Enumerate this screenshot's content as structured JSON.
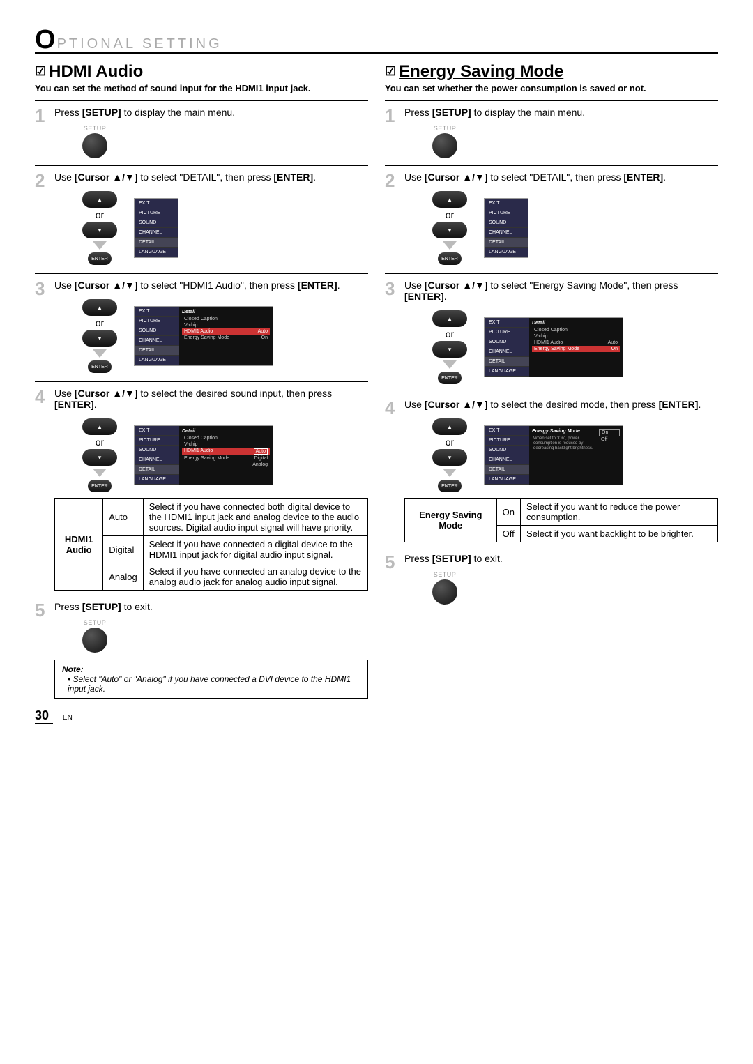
{
  "header": {
    "big_o": "O",
    "rest": "PTIONAL  SETTING"
  },
  "left": {
    "check": "☑",
    "title": "HDMI Audio",
    "subtitle": "You can set the method of sound input for the HDMI1 input jack.",
    "steps": {
      "s1_pre": "Press ",
      "s1_b": "[SETUP]",
      "s1_post": " to display the main menu.",
      "setup_lbl": "SETUP",
      "s2_pre": "Use ",
      "s2_b1": "[Cursor ▲/▼]",
      "s2_mid": " to select \"DETAIL\", then press ",
      "s2_b2": "[ENTER]",
      "s2_post": ".",
      "or": "or",
      "enter_lbl": "ENTER",
      "s3_pre": "Use ",
      "s3_b1": "[Cursor ▲/▼]",
      "s3_mid": " to select \"HDMI1 Audio\", then press ",
      "s3_b2": "[ENTER]",
      "s3_post": ".",
      "s4_pre": "Use ",
      "s4_b1": "[Cursor ▲/▼]",
      "s4_mid": " to select the desired sound input, then press ",
      "s4_b2": "[ENTER]",
      "s4_post": ".",
      "s5_pre": "Press ",
      "s5_b": "[SETUP]",
      "s5_post": " to exit."
    },
    "osd_menu": {
      "exit": "EXIT",
      "picture": "PICTURE",
      "sound": "SOUND",
      "channel": "CHANNEL",
      "detail": "DETAIL",
      "language": "LANGUAGE"
    },
    "osd_detail": {
      "hdr": "Detail",
      "cc": "Closed Caption",
      "vchip": "V-chip",
      "hdmi": "HDMI1 Audio",
      "hdmi_v": "Auto",
      "es": "Energy Saving Mode",
      "es_v": "On",
      "opt_digital": "Digital",
      "opt_analog": "Analog"
    },
    "table": {
      "rowhdr": "HDMI1 Audio",
      "r1a": "Auto",
      "r1b": "Select if you have connected both digital device to the HDMI1 input jack and analog device to the audio sources. Digital audio input signal will have priority.",
      "r2a": "Digital",
      "r2b": "Select if you have connected a digital device to the HDMI1 input jack for digital audio input signal.",
      "r3a": "Analog",
      "r3b": "Select if you have connected an analog device to the analog audio jack for analog audio input signal."
    },
    "note": {
      "hdr": "Note:",
      "li1": "Select \"Auto\" or \"Analog\" if you have connected a DVI device to the HDMI1 input jack."
    }
  },
  "right": {
    "check": "☑",
    "title": "Energy Saving Mode",
    "subtitle": "You can set whether the power consumption is saved or not.",
    "steps": {
      "s1_pre": "Press ",
      "s1_b": "[SETUP]",
      "s1_post": " to display the main menu.",
      "setup_lbl": "SETUP",
      "s2_pre": "Use ",
      "s2_b1": "[Cursor ▲/▼]",
      "s2_mid": " to select \"DETAIL\", then press ",
      "s2_b2": "[ENTER]",
      "s2_post": ".",
      "or": "or",
      "enter_lbl": "ENTER",
      "s3_pre": "Use ",
      "s3_b1": "[Cursor ▲/▼]",
      "s3_mid": " to select \"Energy Saving Mode\", then press ",
      "s3_b2": "[ENTER]",
      "s3_post": ".",
      "s4_pre": "Use ",
      "s4_b1": "[Cursor ▲/▼]",
      "s4_mid": " to select the desired mode, then press ",
      "s4_b2": "[ENTER]",
      "s4_post": ".",
      "s5_pre": "Press ",
      "s5_b": "[SETUP]",
      "s5_post": " to exit."
    },
    "osd_es": {
      "hdr": "Energy Saving Mode",
      "note": "When set to \"On\", power consumption is reduced by decreasing backlight brightness.",
      "on": "On",
      "off": "Off"
    },
    "table": {
      "rowhdr": "Energy Saving Mode",
      "r1a": "On",
      "r1b": "Select if you want to reduce the power consumption.",
      "r2a": "Off",
      "r2b": "Select if you want backlight to be brighter."
    }
  },
  "footer": {
    "page": "30",
    "en": "EN"
  }
}
